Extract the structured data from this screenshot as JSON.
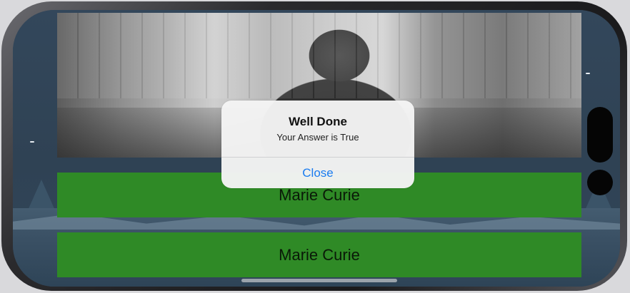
{
  "quiz": {
    "answers": [
      {
        "label": "Marie Curie"
      },
      {
        "label": "Marie Curie"
      }
    ],
    "answer_color": "#2f8a26"
  },
  "alert": {
    "title": "Well Done",
    "message": "Your Answer is True",
    "close_label": "Close",
    "button_color": "#1a7cf0"
  }
}
